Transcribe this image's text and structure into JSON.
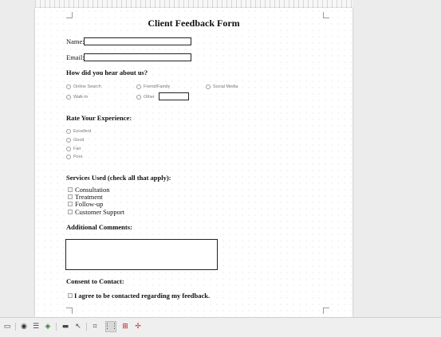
{
  "form": {
    "title": "Client Feedback Form",
    "name_label": "Name:",
    "email_label": "Email:",
    "hear_heading": "How did you hear about us?",
    "hear_options": [
      "Online Search",
      "Friend/Family",
      "Social Media",
      "Walk-In",
      "Other"
    ],
    "experience_heading": "Rate Your Experience:",
    "experience_options": [
      "Excellent",
      "Good",
      "Fair",
      "Poor"
    ],
    "services_heading": "Services Used (check all that apply):",
    "services_options": [
      "Consultation",
      "Treatment",
      "Follow-up",
      "Customer Support"
    ],
    "comments_heading": "Additional Comments:",
    "consent_heading": "Consent to Contact:",
    "consent_label": "I agree to be contacted regarding my feedback."
  },
  "toolbar": {
    "icons": [
      "sidebar-toggle-icon",
      "camera-icon",
      "list-icon",
      "shapes-icon",
      "folder-icon",
      "pointer-icon",
      "crop-icon",
      "grid-icon",
      "snap-grid-icon",
      "guides-icon"
    ]
  }
}
